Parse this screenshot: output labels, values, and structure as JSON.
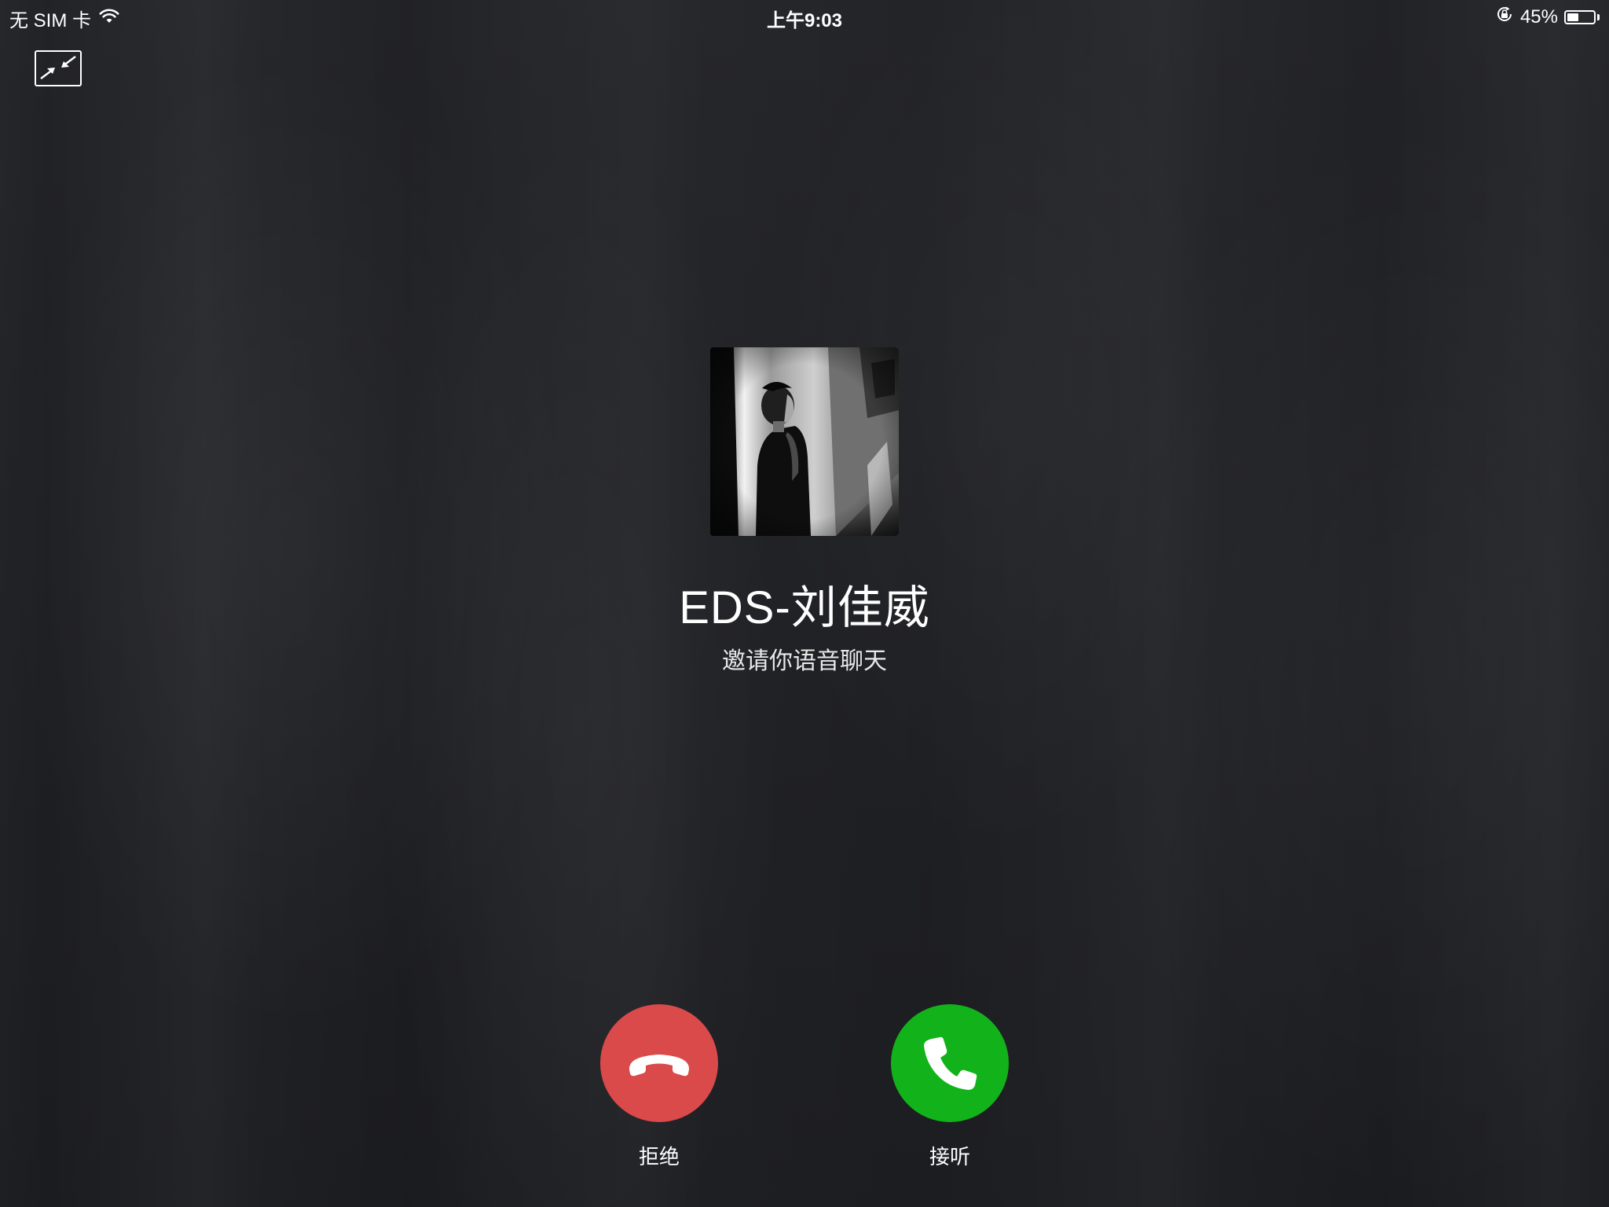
{
  "status_bar": {
    "carrier": "无 SIM 卡",
    "time": "上午9:03",
    "battery_percent": "45%",
    "battery_level": 0.45,
    "icons": [
      "wifi-icon",
      "rotation-lock-icon",
      "battery-icon"
    ]
  },
  "call": {
    "caller_name": "EDS-刘佳威",
    "status_text": "邀请你语音聊天",
    "decline_label": "拒绝",
    "accept_label": "接听"
  },
  "controls": {
    "minimize_icon": "minimize-icon"
  },
  "colors": {
    "background": "#1f2024",
    "decline": "#db4a4a",
    "accept": "#12b31a"
  }
}
